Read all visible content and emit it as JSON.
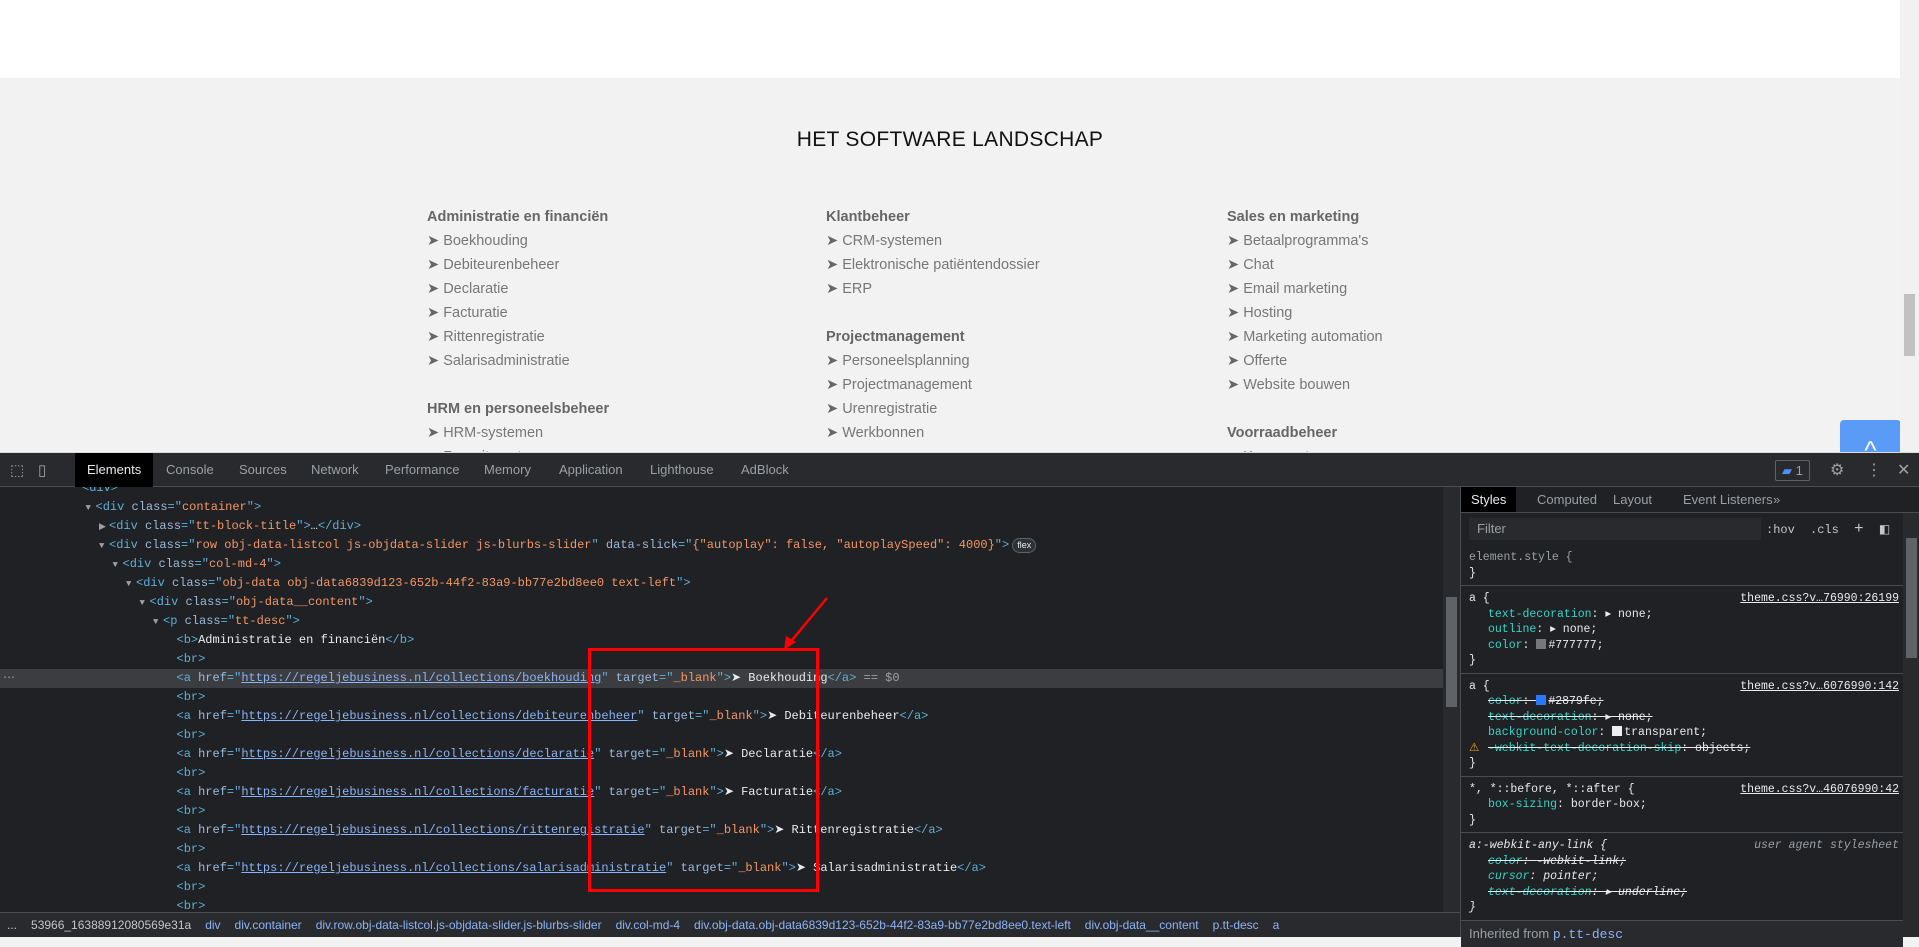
{
  "page": {
    "title": "HET SOFTWARE LANDSCHAP",
    "bullet": "➤",
    "columns": [
      {
        "groups": [
          {
            "heading": "Administratie en financiën",
            "items": [
              "Boekhouding",
              "Debiteurenbeheer",
              "Declaratie",
              "Facturatie",
              "Rittenregistratie",
              "Salarisadministratie"
            ]
          },
          {
            "heading": "HRM en personeelsbeheer",
            "items": [
              "HRM-systemen",
              "Recruitment"
            ]
          }
        ]
      },
      {
        "groups": [
          {
            "heading": "Klantbeheer",
            "items": [
              "CRM-systemen",
              "Elektronische patiëntendossier",
              "ERP"
            ]
          },
          {
            "heading": "Projectmanagement",
            "items": [
              "Personeelsplanning",
              "Projectmanagement",
              "Urenregistratie",
              "Werkbonnen"
            ]
          }
        ]
      },
      {
        "groups": [
          {
            "heading": "Sales en marketing",
            "items": [
              "Betaalprogramma's",
              "Chat",
              "Email marketing",
              "Hosting",
              "Marketing automation",
              "Offerte",
              "Website bouwen"
            ]
          },
          {
            "heading": "Voorraadbeheer",
            "items": [
              "Kassasystemen"
            ]
          }
        ]
      }
    ],
    "to_top_label": "^"
  },
  "devtools": {
    "tabs": [
      "Elements",
      "Console",
      "Sources",
      "Network",
      "Performance",
      "Memory",
      "Application",
      "Lighthouse",
      "AdBlock"
    ],
    "issues_count": "1",
    "dom_lines": [
      {
        "i": 0,
        "s": [
          [
            "tg",
            "<div>"
          ]
        ]
      },
      {
        "i": 1,
        "o": "▼",
        "s": [
          [
            "tg",
            "<div "
          ],
          [
            "an",
            "class"
          ],
          [
            "tg",
            "=\""
          ],
          [
            "av",
            "container"
          ],
          [
            "tg",
            "\">"
          ]
        ]
      },
      {
        "i": 2,
        "o": "▶",
        "s": [
          [
            "tg",
            "<div "
          ],
          [
            "an",
            "class"
          ],
          [
            "tg",
            "=\""
          ],
          [
            "av",
            "tt-block-title"
          ],
          [
            "tg",
            "\">"
          ],
          [
            "tx",
            "…"
          ],
          [
            "tg",
            "</div>"
          ]
        ]
      },
      {
        "i": 2,
        "o": "▼",
        "flex": "flex",
        "s": [
          [
            "tg",
            "<div "
          ],
          [
            "an",
            "class"
          ],
          [
            "tg",
            "=\""
          ],
          [
            "av",
            "row obj-data-listcol js-objdata-slider js-blurbs-slider"
          ],
          [
            "tg",
            "\" "
          ],
          [
            "an",
            "data-slick"
          ],
          [
            "tg",
            "=\""
          ],
          [
            "av",
            "{\"autoplay\": false, \"autoplaySpeed\": 4000}"
          ],
          [
            "tg",
            "\">"
          ]
        ]
      },
      {
        "i": 3,
        "o": "▼",
        "s": [
          [
            "tg",
            "<div "
          ],
          [
            "an",
            "class"
          ],
          [
            "tg",
            "=\""
          ],
          [
            "av",
            "col-md-4"
          ],
          [
            "tg",
            "\">"
          ]
        ]
      },
      {
        "i": 4,
        "o": "▼",
        "s": [
          [
            "tg",
            "<div "
          ],
          [
            "an",
            "class"
          ],
          [
            "tg",
            "=\""
          ],
          [
            "av",
            "obj-data obj-data6839d123-652b-44f2-83a9-bb77e2bd8ee0 text-left"
          ],
          [
            "tg",
            "\">"
          ]
        ]
      },
      {
        "i": 5,
        "o": "▼",
        "s": [
          [
            "tg",
            "<div "
          ],
          [
            "an",
            "class"
          ],
          [
            "tg",
            "=\""
          ],
          [
            "av",
            "obj-data__content"
          ],
          [
            "tg",
            "\">"
          ]
        ]
      },
      {
        "i": 6,
        "o": "▼",
        "s": [
          [
            "tg",
            "<p "
          ],
          [
            "an",
            "class"
          ],
          [
            "tg",
            "=\""
          ],
          [
            "av",
            "tt-desc"
          ],
          [
            "tg",
            "\">"
          ]
        ]
      },
      {
        "i": 7,
        "s": [
          [
            "tg",
            "<b>"
          ],
          [
            "tx",
            "Administratie en financiën"
          ],
          [
            "tg",
            "</b>"
          ]
        ]
      },
      {
        "i": 7,
        "s": [
          [
            "tg",
            "<br>"
          ]
        ]
      },
      {
        "i": 7,
        "sel": true,
        "s": [
          [
            "tg",
            "<a "
          ],
          [
            "an",
            "href"
          ],
          [
            "tg",
            "=\""
          ],
          [
            "ur",
            "https://regeljebusiness.nl/collections/boekhouding"
          ],
          [
            "tg",
            "\" "
          ],
          [
            "an",
            "target"
          ],
          [
            "tg",
            "=\""
          ],
          [
            "av",
            "_blank"
          ],
          [
            "tg",
            "\">"
          ],
          [
            "tx",
            "➤ Boekhouding"
          ],
          [
            "tg",
            "</a>"
          ],
          [
            "eq",
            " == $0"
          ]
        ]
      },
      {
        "i": 7,
        "s": [
          [
            "tg",
            "<br>"
          ]
        ]
      },
      {
        "i": 7,
        "s": [
          [
            "tg",
            "<a "
          ],
          [
            "an",
            "href"
          ],
          [
            "tg",
            "=\""
          ],
          [
            "ur",
            "https://regeljebusiness.nl/collections/debiteurenbeheer"
          ],
          [
            "tg",
            "\" "
          ],
          [
            "an",
            "target"
          ],
          [
            "tg",
            "=\""
          ],
          [
            "av",
            "_blank"
          ],
          [
            "tg",
            "\">"
          ],
          [
            "tx",
            "➤ Debiteurenbeheer"
          ],
          [
            "tg",
            "</a>"
          ]
        ]
      },
      {
        "i": 7,
        "s": [
          [
            "tg",
            "<br>"
          ]
        ]
      },
      {
        "i": 7,
        "s": [
          [
            "tg",
            "<a "
          ],
          [
            "an",
            "href"
          ],
          [
            "tg",
            "=\""
          ],
          [
            "ur",
            "https://regeljebusiness.nl/collections/declaratie"
          ],
          [
            "tg",
            "\" "
          ],
          [
            "an",
            "target"
          ],
          [
            "tg",
            "=\""
          ],
          [
            "av",
            "_blank"
          ],
          [
            "tg",
            "\">"
          ],
          [
            "tx",
            "➤ Declaratie"
          ],
          [
            "tg",
            "</a>"
          ]
        ]
      },
      {
        "i": 7,
        "s": [
          [
            "tg",
            "<br>"
          ]
        ]
      },
      {
        "i": 7,
        "s": [
          [
            "tg",
            "<a "
          ],
          [
            "an",
            "href"
          ],
          [
            "tg",
            "=\""
          ],
          [
            "ur",
            "https://regeljebusiness.nl/collections/facturatie"
          ],
          [
            "tg",
            "\" "
          ],
          [
            "an",
            "target"
          ],
          [
            "tg",
            "=\""
          ],
          [
            "av",
            "_blank"
          ],
          [
            "tg",
            "\">"
          ],
          [
            "tx",
            "➤ Facturatie"
          ],
          [
            "tg",
            "</a>"
          ]
        ]
      },
      {
        "i": 7,
        "s": [
          [
            "tg",
            "<br>"
          ]
        ]
      },
      {
        "i": 7,
        "s": [
          [
            "tg",
            "<a "
          ],
          [
            "an",
            "href"
          ],
          [
            "tg",
            "=\""
          ],
          [
            "ur",
            "https://regeljebusiness.nl/collections/rittenregistratie"
          ],
          [
            "tg",
            "\" "
          ],
          [
            "an",
            "target"
          ],
          [
            "tg",
            "=\""
          ],
          [
            "av",
            "_blank"
          ],
          [
            "tg",
            "\">"
          ],
          [
            "tx",
            "➤ Rittenregistratie"
          ],
          [
            "tg",
            "</a>"
          ]
        ]
      },
      {
        "i": 7,
        "s": [
          [
            "tg",
            "<br>"
          ]
        ]
      },
      {
        "i": 7,
        "s": [
          [
            "tg",
            "<a "
          ],
          [
            "an",
            "href"
          ],
          [
            "tg",
            "=\""
          ],
          [
            "ur",
            "https://regeljebusiness.nl/collections/salarisadministratie"
          ],
          [
            "tg",
            "\" "
          ],
          [
            "an",
            "target"
          ],
          [
            "tg",
            "=\""
          ],
          [
            "av",
            "_blank"
          ],
          [
            "tg",
            "\">"
          ],
          [
            "tx",
            "➤ Salarisadministratie"
          ],
          [
            "tg",
            "</a>"
          ]
        ]
      },
      {
        "i": 7,
        "s": [
          [
            "tg",
            "<br>"
          ]
        ]
      },
      {
        "i": 7,
        "s": [
          [
            "tg",
            "<br>"
          ]
        ]
      }
    ],
    "breadcrumbs": [
      "...",
      "53966_16388912080569e31a",
      "div",
      "div.container",
      "div.row.obj-data-listcol.js-objdata-slider.js-blurbs-slider",
      "div.col-md-4",
      "div.obj-data.obj-data6839d123-652b-44f2-83a9-bb77e2bd8ee0.text-left",
      "div.obj-data__content",
      "p.tt-desc",
      "a"
    ],
    "styles": {
      "tabs": [
        "Styles",
        "Computed",
        "Layout",
        "Event Listeners",
        "»"
      ],
      "filter_placeholder": "Filter",
      "hov": ":hov",
      "cls": ".cls",
      "add": "+",
      "element_style": "element.style {",
      "close": "}",
      "rule1": {
        "sel": "a {",
        "src": "theme.css?v…76990:26199",
        "p1n": "text-decoration",
        "p1v": "none;",
        "p2n": "outline",
        "p2v": "none;",
        "p3n": "color",
        "p3v": "#777777;",
        "swatch": "#777777"
      },
      "rule2": {
        "sel": "a {",
        "src": "theme.css?v…6076990:142",
        "p1n": "color",
        "p1v": "#2879fe;",
        "swatch": "#2879fe",
        "p2n": "text-decoration",
        "p2v": "none;",
        "p3n": "background-color",
        "p3v": "transparent;",
        "p4n": "-webkit-text-decoration-skip",
        "p4v": "objects;"
      },
      "rule3": {
        "sel": "*, *::before, *::after {",
        "src": "theme.css?v…46076990:42",
        "p1n": "box-sizing",
        "p1v": "border-box;"
      },
      "rule4": {
        "sel": "a:-webkit-any-link {",
        "src": "user agent stylesheet",
        "p1n": "color",
        "p1v": "-webkit-link;",
        "p2n": "cursor",
        "p2v": "pointer;",
        "p3n": "text-decoration",
        "p3v": "underline;"
      },
      "inherited_label": "Inherited from",
      "inherited_sel": "p.tt-desc"
    }
  }
}
